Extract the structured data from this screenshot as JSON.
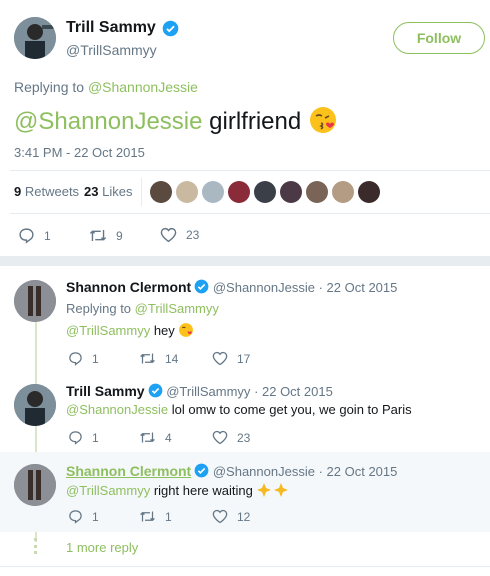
{
  "main_tweet": {
    "author_name": "Trill Sammy",
    "author_handle": "@TrillSammyy",
    "follow_label": "Follow",
    "replying_prefix": "Replying to",
    "replying_handle": "@ShannonJessie",
    "text_mention": "@ShannonJessie",
    "text_body": " girlfriend",
    "timestamp": "3:41 PM - 22 Oct 2015",
    "retweets_count": "9",
    "retweets_label": "Retweets",
    "likes_count": "23",
    "likes_label": "Likes",
    "actions": {
      "replies": "1",
      "retweets": "9",
      "likes": "23"
    }
  },
  "replies": [
    {
      "name": "Shannon Clermont",
      "handle": "@ShannonJessie",
      "date": "· 22 Oct 2015",
      "replying_prefix": "Replying to",
      "replying_handle": "@TrillSammyy",
      "mention": "@TrillSammyy",
      "text": " hey",
      "replies": "1",
      "retweets": "14",
      "likes": "17"
    },
    {
      "name": "Trill Sammy",
      "handle": "@TrillSammyy",
      "date": "· 22 Oct 2015",
      "mention": "@ShannonJessie",
      "text": " lol omw to come get you, we goin to Paris",
      "replies": "1",
      "retweets": "4",
      "likes": "23"
    },
    {
      "name": "Shannon Clermont",
      "handle": "@ShannonJessie",
      "date": "· 22 Oct 2015",
      "mention": "@TrillSammyy",
      "text": " right here waiting",
      "replies": "1",
      "retweets": "1",
      "likes": "12"
    }
  ],
  "more_replies_label": "1 more reply",
  "colors": {
    "accent": "#8ebf5f",
    "verified": "#1da1f2",
    "muted": "#657786",
    "highlight_bg": "#f5f8fa"
  }
}
